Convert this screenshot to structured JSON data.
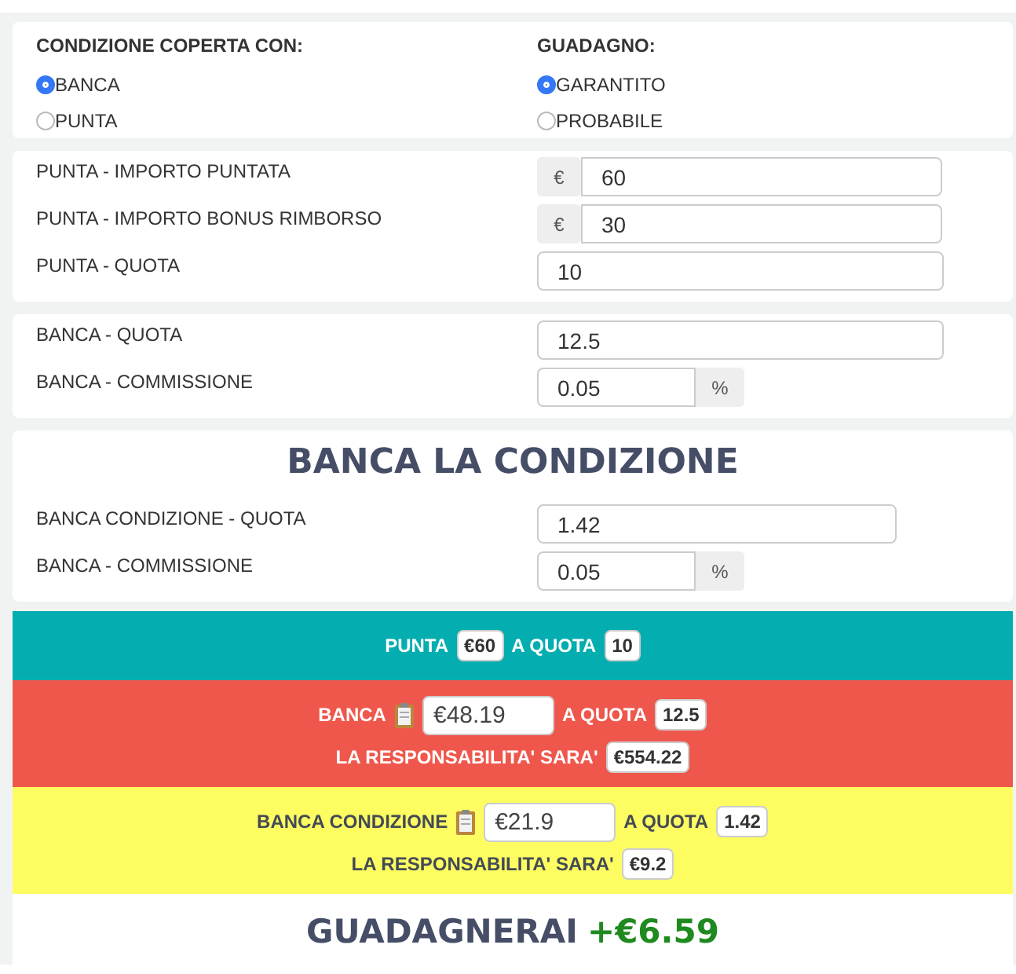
{
  "options": [
    {
      "title": "CONDIZIONE COPERTA CON:",
      "choices": [
        {
          "label": "BANCA",
          "selected": true
        },
        {
          "label": "PUNTA",
          "selected": false
        }
      ]
    },
    {
      "title": "GUADAGNO:",
      "choices": [
        {
          "label": "GARANTITO",
          "selected": true
        },
        {
          "label": "PROBABILE",
          "selected": false
        }
      ]
    }
  ],
  "sections": [
    {
      "rows": [
        {
          "label": "PUNTA - IMPORTO PUNTATA",
          "kind": "prefix",
          "addon": "€",
          "value": "60"
        },
        {
          "label": "PUNTA - IMPORTO BONUS RIMBORSO",
          "kind": "prefix",
          "addon": "€",
          "value": "30"
        },
        {
          "label": "PUNTA - QUOTA",
          "kind": "plain",
          "value": "10"
        }
      ]
    },
    {
      "rows": [
        {
          "label": "BANCA - QUOTA",
          "kind": "plain",
          "value": "12.5"
        },
        {
          "label": "BANCA - COMMISSIONE",
          "kind": "suffix",
          "addon": "%",
          "value": "0.05"
        }
      ]
    },
    {
      "heading": "BANCA LA CONDIZIONE",
      "rows": [
        {
          "label": "BANCA CONDIZIONE - QUOTA",
          "kind": "plain",
          "value": "1.42"
        },
        {
          "label": "BANCA - COMMISSIONE",
          "kind": "suffix",
          "addon": "%",
          "value": "0.05"
        }
      ]
    }
  ],
  "results": [
    {
      "kind": "punta",
      "color": "#04adb0",
      "label": "PUNTA",
      "stake": "€60",
      "quota_label": "A QUOTA",
      "quota": "10"
    },
    {
      "kind": "banca",
      "color": "#f0574c",
      "label": "BANCA",
      "stake": "€48.19",
      "quota_label": "A QUOTA",
      "quota": "12.5",
      "liability_label": "LA RESPONSABILITA' SARA'",
      "liability": "€554.22"
    },
    {
      "kind": "condizione",
      "color": "#fdfd62",
      "label": "BANCA CONDIZIONE",
      "stake": "€21.9",
      "quota_label": "A QUOTA",
      "quota": "1.42",
      "liability_label": "LA RESPONSABILITA' SARA'",
      "liability": "€9.2"
    }
  ],
  "profit": {
    "label": "GUADAGNERAI",
    "value": "+€6.59"
  }
}
